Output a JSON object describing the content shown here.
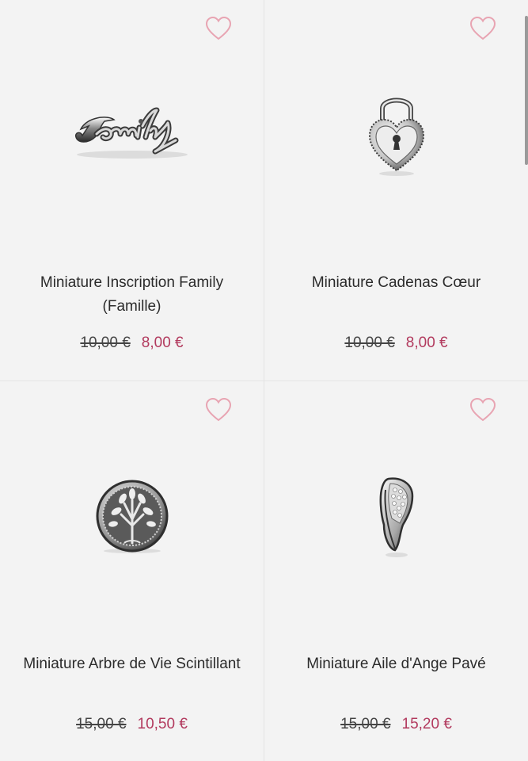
{
  "colors": {
    "sale_price": "#b23a5e",
    "wishlist_heart": "#e8a4b2",
    "card_background": "#f3f3f3"
  },
  "products": [
    {
      "name": "Miniature Inscription Family (Famille)",
      "old_price": "10,00 €",
      "price": "8,00 €",
      "image": "family-script-charm",
      "wishlist_icon": "heart-outline-icon"
    },
    {
      "name": "Miniature Cadenas Cœur",
      "old_price": "10,00 €",
      "price": "8,00 €",
      "image": "heart-padlock-charm",
      "wishlist_icon": "heart-outline-icon"
    },
    {
      "name": "Miniature Arbre de Vie Scintillant",
      "old_price": "15,00 €",
      "price": "10,50 €",
      "image": "tree-of-life-charm",
      "wishlist_icon": "heart-outline-icon"
    },
    {
      "name": "Miniature Aile d'Ange Pavé",
      "old_price": "15,00 €",
      "price": "15,20 €",
      "image": "angel-wing-charm",
      "wishlist_icon": "heart-outline-icon"
    }
  ]
}
